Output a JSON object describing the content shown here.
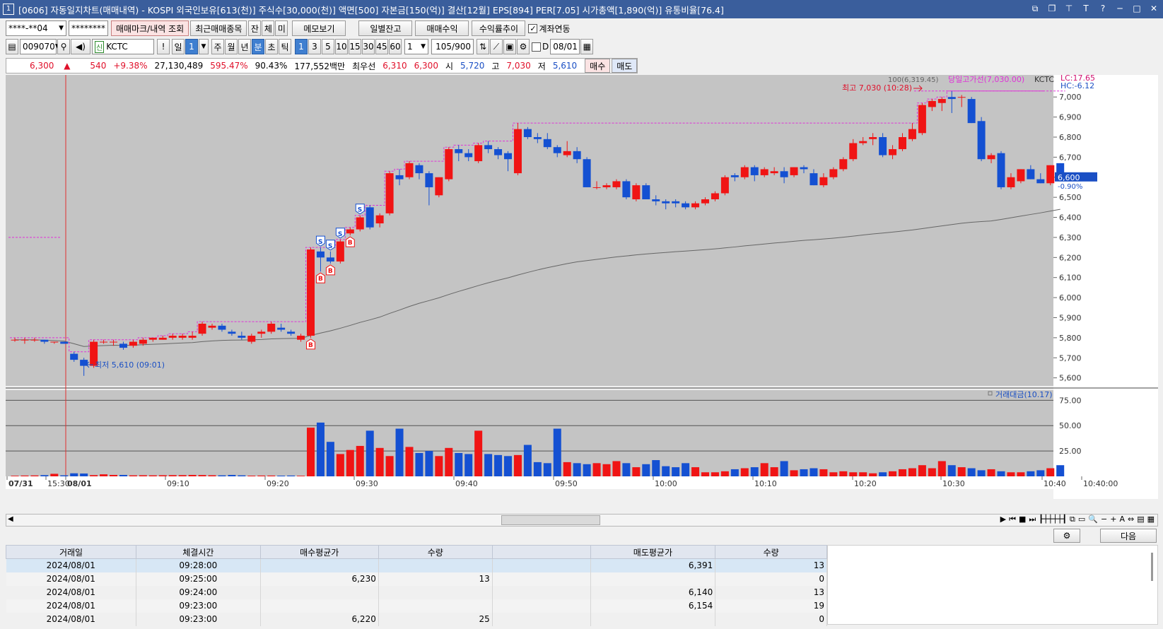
{
  "window": {
    "title": "[0606] 자동일지차트(매매내역) - KOSPI 외국인보유[613(천)] 주식수[30,000(천)] 액면[500] 자본금[150(억)] 결산[12월] EPS[894] PER[7.05] 시가총액[1,890(억)] 유통비율[76.4]",
    "icon_text": "1"
  },
  "toolbar1": {
    "account": "****-**04",
    "password": "********",
    "btn_mark": "매매마크/내역 조회",
    "btn_recent": "최근매매종목",
    "btn_jan": "잔",
    "btn_che": "체",
    "btn_mi": "미",
    "btn_memo": "메모보기",
    "btn_daily": "일별잔고",
    "btn_profit": "매매수익",
    "btn_yield": "수익률추이",
    "chk_link": "계좌연동"
  },
  "toolbar2": {
    "code": "009070",
    "name": "KCTC",
    "excl": "!",
    "day": "일",
    "day_num": "1",
    "week": "주",
    "month": "월",
    "year": "년",
    "minute": "분",
    "second": "초",
    "tick": "틱",
    "intervals": [
      "1",
      "3",
      "5",
      "10",
      "15",
      "30",
      "45",
      "60"
    ],
    "unit": "1",
    "count": "105",
    "count_total": "/900",
    "d_label": "D",
    "date": "08/01"
  },
  "quote": {
    "price": "6,300",
    "arrow": "▲",
    "change": "540",
    "change_pct": "+9.38%",
    "volume": "27,130,489",
    "vol_ratio": "595.47%",
    "turnover": "90.43%",
    "amount": "177,552백만",
    "best_label": "최우선",
    "best_ask": "6,310",
    "best_bid": "6,300",
    "open_label": "시",
    "open": "5,720",
    "high_label": "고",
    "high": "7,030",
    "low_label": "저",
    "low": "5,610",
    "buy": "매수",
    "sell": "매도"
  },
  "chart_labels": {
    "ma_label": "100(6,319.45)",
    "high_line": "당일고가선(7,030.00)",
    "ticker": "KCTC",
    "lc": "LC:17.65",
    "hc": "HC:-6.12",
    "high_annot": "최고 7,030 (10:28)",
    "low_annot": "최저 5,610 (09:01)",
    "last_price": "6,600",
    "last_pct": "-0.90%",
    "vol_title": "거래대금(10.17)"
  },
  "chart_data": {
    "type": "candlestick",
    "price_ticks": [
      "7,000",
      "6,900",
      "6,800",
      "6,700",
      "6,600",
      "6,500",
      "6,400",
      "6,300",
      "6,200",
      "6,100",
      "6,000",
      "5,900",
      "5,800",
      "5,700",
      "5,600"
    ],
    "price_range": [
      5560,
      7110
    ],
    "vol_ticks": [
      "75.00",
      "50.00",
      "25.00"
    ],
    "vol_range": [
      0,
      85
    ],
    "x_labels": [
      "07/31",
      "15:30",
      "08/01",
      "09:10",
      "09:20",
      "09:30",
      "09:40",
      "09:50",
      "10:00",
      "10:10",
      "10:20",
      "10:30",
      "10:40",
      "10:40:00"
    ],
    "candles": [
      [
        5790,
        5800,
        5780,
        5790
      ],
      [
        5790,
        5800,
        5770,
        5790
      ],
      [
        5790,
        5800,
        5780,
        5790
      ],
      [
        5790,
        5790,
        5770,
        5780
      ],
      [
        5780,
        5780,
        5770,
        5780
      ],
      [
        5780,
        5780,
        5770,
        5770
      ],
      [
        5720,
        5730,
        5680,
        5690
      ],
      [
        5690,
        5700,
        5610,
        5660
      ],
      [
        5660,
        5790,
        5650,
        5780
      ],
      [
        5780,
        5790,
        5770,
        5780
      ],
      [
        5780,
        5790,
        5760,
        5780
      ],
      [
        5770,
        5780,
        5740,
        5750
      ],
      [
        5760,
        5790,
        5750,
        5780
      ],
      [
        5770,
        5800,
        5760,
        5790
      ],
      [
        5790,
        5800,
        5780,
        5800
      ],
      [
        5790,
        5810,
        5790,
        5800
      ],
      [
        5800,
        5820,
        5790,
        5810
      ],
      [
        5800,
        5820,
        5790,
        5810
      ],
      [
        5800,
        5830,
        5790,
        5810
      ],
      [
        5820,
        5880,
        5810,
        5870
      ],
      [
        5850,
        5870,
        5840,
        5860
      ],
      [
        5860,
        5870,
        5830,
        5840
      ],
      [
        5830,
        5840,
        5810,
        5820
      ],
      [
        5810,
        5830,
        5790,
        5800
      ],
      [
        5780,
        5820,
        5770,
        5810
      ],
      [
        5820,
        5840,
        5800,
        5830
      ],
      [
        5830,
        5880,
        5820,
        5870
      ],
      [
        5850,
        5870,
        5830,
        5840
      ],
      [
        5830,
        5840,
        5810,
        5820
      ],
      [
        5790,
        5820,
        5780,
        5810
      ],
      [
        5810,
        6250,
        5800,
        6240
      ],
      [
        6230,
        6250,
        6130,
        6200
      ],
      [
        6200,
        6230,
        6170,
        6180
      ],
      [
        6180,
        6290,
        6170,
        6280
      ],
      [
        6320,
        6350,
        6310,
        6340
      ],
      [
        6340,
        6410,
        6330,
        6400
      ],
      [
        6450,
        6460,
        6340,
        6350
      ],
      [
        6370,
        6420,
        6350,
        6410
      ],
      [
        6420,
        6630,
        6410,
        6620
      ],
      [
        6610,
        6640,
        6560,
        6590
      ],
      [
        6600,
        6680,
        6590,
        6670
      ],
      [
        6660,
        6670,
        6590,
        6620
      ],
      [
        6620,
        6630,
        6460,
        6550
      ],
      [
        6510,
        6600,
        6500,
        6600
      ],
      [
        6590,
        6750,
        6580,
        6740
      ],
      [
        6740,
        6760,
        6680,
        6720
      ],
      [
        6720,
        6740,
        6680,
        6700
      ],
      [
        6680,
        6770,
        6670,
        6760
      ],
      [
        6760,
        6780,
        6720,
        6740
      ],
      [
        6740,
        6750,
        6690,
        6710
      ],
      [
        6720,
        6730,
        6630,
        6690
      ],
      [
        6620,
        6870,
        6610,
        6840
      ],
      [
        6840,
        6850,
        6790,
        6800
      ],
      [
        6800,
        6820,
        6770,
        6790
      ],
      [
        6790,
        6820,
        6740,
        6750
      ],
      [
        6750,
        6760,
        6700,
        6720
      ],
      [
        6710,
        6780,
        6700,
        6730
      ],
      [
        6730,
        6750,
        6670,
        6690
      ],
      [
        6690,
        6700,
        6550,
        6550
      ],
      [
        6550,
        6580,
        6540,
        6550
      ],
      [
        6550,
        6570,
        6540,
        6560
      ],
      [
        6550,
        6590,
        6540,
        6580
      ],
      [
        6580,
        6590,
        6490,
        6500
      ],
      [
        6490,
        6570,
        6480,
        6560
      ],
      [
        6560,
        6570,
        6490,
        6490
      ],
      [
        6490,
        6510,
        6460,
        6480
      ],
      [
        6480,
        6490,
        6440,
        6470
      ],
      [
        6480,
        6490,
        6450,
        6470
      ],
      [
        6470,
        6480,
        6440,
        6450
      ],
      [
        6450,
        6480,
        6440,
        6470
      ],
      [
        6470,
        6500,
        6460,
        6490
      ],
      [
        6490,
        6530,
        6480,
        6520
      ],
      [
        6520,
        6610,
        6510,
        6600
      ],
      [
        6610,
        6620,
        6580,
        6600
      ],
      [
        6600,
        6660,
        6590,
        6650
      ],
      [
        6650,
        6660,
        6580,
        6610
      ],
      [
        6610,
        6650,
        6600,
        6640
      ],
      [
        6620,
        6650,
        6610,
        6630
      ],
      [
        6630,
        6650,
        6570,
        6600
      ],
      [
        6610,
        6650,
        6600,
        6650
      ],
      [
        6650,
        6660,
        6620,
        6640
      ],
      [
        6620,
        6640,
        6560,
        6560
      ],
      [
        6560,
        6620,
        6550,
        6600
      ],
      [
        6600,
        6650,
        6590,
        6640
      ],
      [
        6640,
        6700,
        6630,
        6690
      ],
      [
        6690,
        6790,
        6680,
        6770
      ],
      [
        6770,
        6800,
        6760,
        6780
      ],
      [
        6790,
        6820,
        6760,
        6800
      ],
      [
        6800,
        6820,
        6700,
        6710
      ],
      [
        6710,
        6760,
        6690,
        6740
      ],
      [
        6740,
        6820,
        6730,
        6800
      ],
      [
        6790,
        6870,
        6780,
        6840
      ],
      [
        6820,
        6970,
        6810,
        6960
      ],
      [
        6950,
        6990,
        6930,
        6980
      ],
      [
        6970,
        7000,
        6930,
        6990
      ],
      [
        7000,
        7030,
        6920,
        6990
      ],
      [
        7000,
        7010,
        6950,
        7000
      ],
      [
        6990,
        7000,
        6870,
        6870
      ],
      [
        6880,
        6900,
        6680,
        6690
      ],
      [
        6690,
        6720,
        6670,
        6710
      ],
      [
        6720,
        6730,
        6540,
        6550
      ],
      [
        6550,
        6620,
        6540,
        6600
      ],
      [
        6580,
        6640,
        6570,
        6640
      ],
      [
        6640,
        6660,
        6590,
        6590
      ],
      [
        6590,
        6620,
        6570,
        6570
      ],
      [
        6570,
        6660,
        6560,
        6660
      ],
      [
        6670,
        6670,
        6590,
        6600
      ]
    ],
    "volumes": [
      0.6,
      0.8,
      0.9,
      1.2,
      2.5,
      1.0,
      3.0,
      2.8,
      1.2,
      2.0,
      1.4,
      1.4,
      1.0,
      1.1,
      1.0,
      1.1,
      1.2,
      1.2,
      1.4,
      1.3,
      1.1,
      1.0,
      1.4,
      1.0,
      0.7,
      0.8,
      0.8,
      0.7,
      0.8,
      0.6,
      48,
      53,
      34,
      22,
      26,
      30,
      45,
      28,
      20,
      47,
      29,
      23,
      25,
      20,
      28,
      23,
      22,
      45,
      22,
      21,
      20,
      21,
      31,
      14,
      13,
      47,
      14,
      13,
      12,
      13,
      12,
      15,
      13,
      9,
      12,
      16,
      10,
      9,
      13,
      9,
      4,
      4,
      5,
      7,
      8,
      9,
      13,
      9,
      15,
      6,
      7,
      8,
      7,
      4,
      5,
      4,
      4,
      3,
      4,
      5,
      7,
      8,
      11,
      8,
      15,
      11,
      9,
      8,
      6,
      7,
      5,
      4,
      4,
      5,
      6,
      8,
      11,
      10,
      13,
      14,
      10,
      9,
      8,
      8,
      8,
      7,
      6,
      4,
      4,
      3,
      4,
      10,
      16,
      11,
      6,
      7,
      13,
      25,
      18,
      18,
      13,
      31,
      12,
      15,
      28,
      15,
      20,
      12,
      13,
      18,
      25,
      10,
      11,
      34,
      30,
      21,
      33,
      22,
      13
    ],
    "markers": [
      {
        "idx": 30,
        "kind": "B"
      },
      {
        "idx": 31,
        "kind": "B"
      },
      {
        "idx": 31,
        "kind": "S"
      },
      {
        "idx": 32,
        "kind": "B"
      },
      {
        "idx": 32,
        "kind": "S"
      },
      {
        "idx": 33,
        "kind": "S"
      },
      {
        "idx": 34,
        "kind": "B"
      },
      {
        "idx": 35,
        "kind": "S"
      }
    ]
  },
  "table": {
    "headers": [
      "거래일",
      "체결시간",
      "매수평균가",
      "수량",
      "",
      "매도평균가",
      "수량"
    ],
    "rows": [
      [
        "2024/08/01",
        "09:28:00",
        "",
        "",
        "",
        "6,391",
        "13"
      ],
      [
        "2024/08/01",
        "09:25:00",
        "6,230",
        "13",
        "",
        "",
        "0"
      ],
      [
        "2024/08/01",
        "09:24:00",
        "",
        "",
        "",
        "6,140",
        "13"
      ],
      [
        "2024/08/01",
        "09:23:00",
        "",
        "",
        "",
        "6,154",
        "19"
      ],
      [
        "2024/08/01",
        "09:23:00",
        "6,220",
        "25",
        "",
        "",
        "0"
      ]
    ]
  },
  "bottom": {
    "next": "다음"
  },
  "colors": {
    "up": "#f01414",
    "down": "#1450d2",
    "title_bg": "#3a5e9c",
    "chart_bg": "#c4c4c4",
    "high_line": "#e030d8"
  }
}
